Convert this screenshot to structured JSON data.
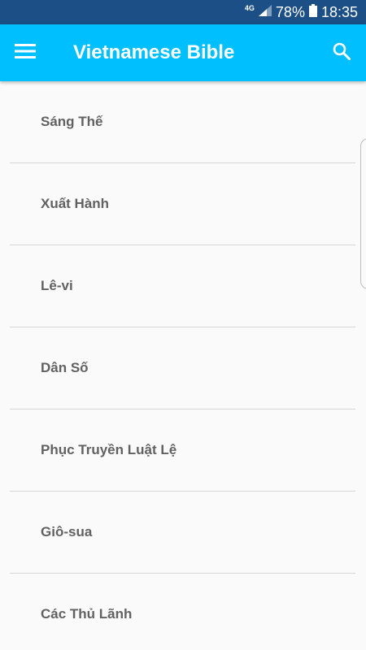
{
  "status_bar": {
    "network": "4G",
    "battery": "78%",
    "time": "18:35"
  },
  "app_bar": {
    "title": "Vietnamese Bible",
    "menu_icon": "hamburger-menu-icon",
    "search_icon": "search-icon"
  },
  "books": [
    {
      "label": "Sáng Thế"
    },
    {
      "label": "Xuất Hành"
    },
    {
      "label": "Lê-vi"
    },
    {
      "label": "Dân Số"
    },
    {
      "label": "Phục Truyền Luật Lệ"
    },
    {
      "label": "Giô-sua"
    },
    {
      "label": "Các Thủ Lãnh"
    }
  ],
  "colors": {
    "status_bar": "#1b4f86",
    "app_bar": "#00bfff",
    "background": "#fafafa",
    "item_text": "#616161",
    "divider": "#d6d6d6"
  }
}
